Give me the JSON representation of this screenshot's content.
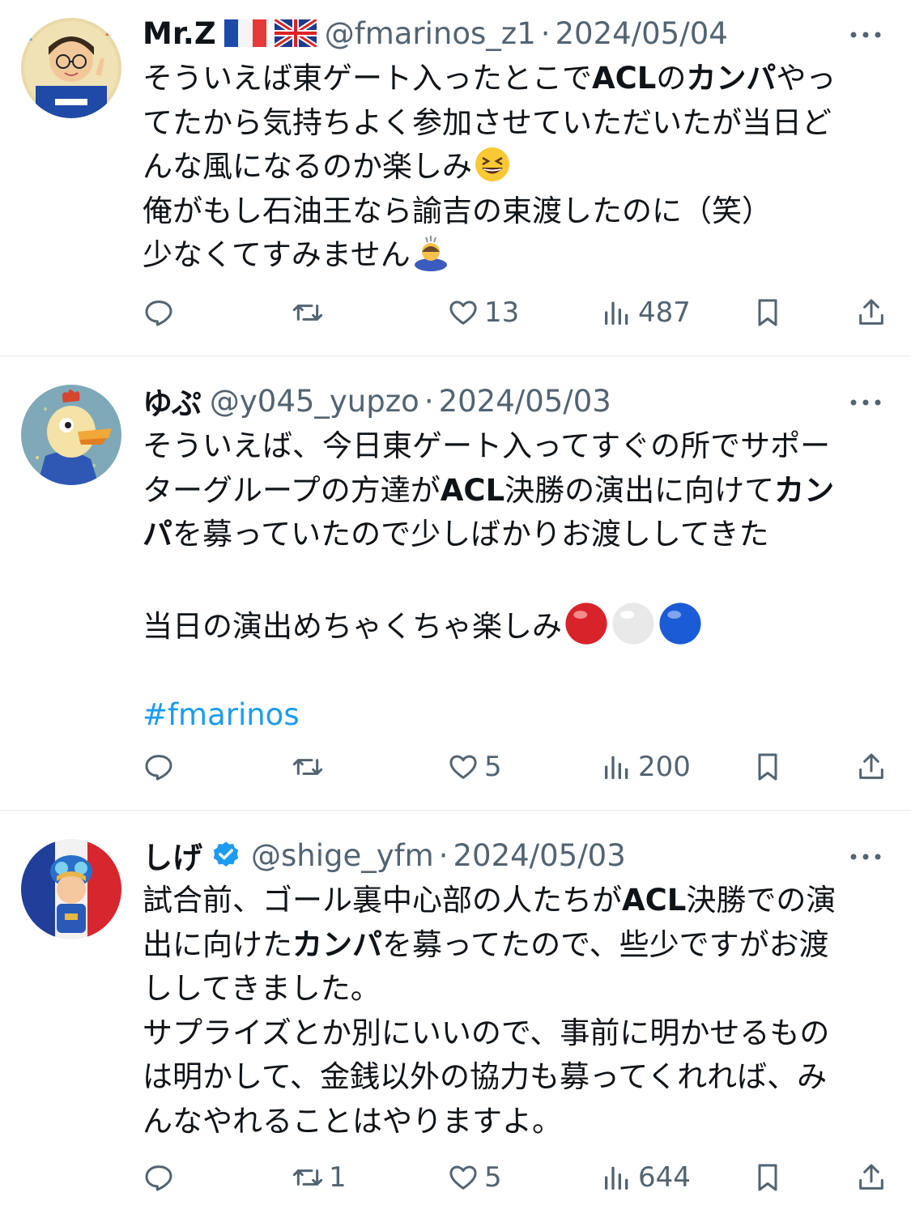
{
  "tweets": [
    {
      "name": "Mr.Z",
      "handle": "@fmarinos_z1",
      "separator": "·",
      "date": "2024/05/04",
      "lines": [
        "そういえば東ゲート入ったとこでACLのカンパやっ",
        "てたから気持ちよく参加させていただいたが当日ど",
        "んな風になるのか楽しみ",
        "俺がもし石油王なら諭吉の束渡したのに（笑）",
        "少なくてすみません"
      ],
      "replies": "",
      "retweets": "",
      "likes": "13",
      "views": "487"
    },
    {
      "name": "ゆぷ",
      "handle": "@y045_yupzo",
      "separator": "·",
      "date": "2024/05/03",
      "lines": [
        "そういえば、今日東ゲート入ってすぐの所でサポー",
        "ターグループの方達がACL決勝の演出に向けてカン",
        "パを募っていたので少しばかりお渡ししてきた",
        "",
        "当日の演出めちゃくちゃ楽しみ",
        "",
        "#fmarinos"
      ],
      "replies": "",
      "retweets": "",
      "likes": "5",
      "views": "200"
    },
    {
      "name": "しげ",
      "handle": "@shige_yfm",
      "separator": "·",
      "date": "2024/05/03",
      "lines": [
        "試合前、ゴール裏中心部の人たちがACL決勝での演",
        "出に向けたカンパを募ってたので、些少ですがお渡",
        "ししてきました。",
        "サプライズとか別にいいので、事前に明かせるもの",
        "は明かして、金銭以外の協力も募ってくれれば、み",
        "んなやれることはやりますよ。"
      ],
      "replies": "",
      "retweets": "1",
      "likes": "5",
      "views": "644"
    }
  ],
  "colors": {
    "text": "#0f1419",
    "secondary": "#536471",
    "link": "#1d9bf0",
    "divider": "#e6e9eb",
    "verified": "#1d9bf0"
  },
  "icons": {
    "reply": "reply-icon",
    "retweet": "retweet-icon",
    "like": "heart-icon",
    "views": "views-icon",
    "bookmark": "bookmark-icon",
    "share": "share-icon",
    "more": "more-icon"
  }
}
